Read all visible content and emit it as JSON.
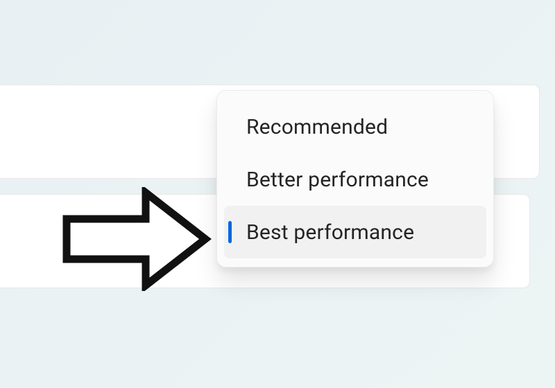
{
  "menu": {
    "items": [
      {
        "label": "Recommended",
        "selected": false
      },
      {
        "label": "Better performance",
        "selected": false
      },
      {
        "label": "Best performance",
        "selected": true
      }
    ]
  }
}
